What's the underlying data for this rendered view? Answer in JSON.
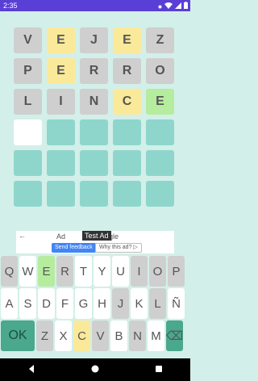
{
  "status": {
    "time": "2:35"
  },
  "board": {
    "rows": [
      [
        {
          "l": "V",
          "s": "absent"
        },
        {
          "l": "E",
          "s": "present"
        },
        {
          "l": "J",
          "s": "absent"
        },
        {
          "l": "E",
          "s": "present"
        },
        {
          "l": "Z",
          "s": "absent"
        }
      ],
      [
        {
          "l": "P",
          "s": "absent"
        },
        {
          "l": "E",
          "s": "present"
        },
        {
          "l": "R",
          "s": "absent"
        },
        {
          "l": "R",
          "s": "absent"
        },
        {
          "l": "O",
          "s": "absent"
        }
      ],
      [
        {
          "l": "L",
          "s": "absent"
        },
        {
          "l": "I",
          "s": "absent"
        },
        {
          "l": "N",
          "s": "absent"
        },
        {
          "l": "C",
          "s": "present"
        },
        {
          "l": "E",
          "s": "correct"
        }
      ],
      [
        {
          "l": "",
          "s": "active"
        },
        {
          "l": "",
          "s": "empty"
        },
        {
          "l": "",
          "s": "empty"
        },
        {
          "l": "",
          "s": "empty"
        },
        {
          "l": "",
          "s": "empty"
        }
      ],
      [
        {
          "l": "",
          "s": "empty"
        },
        {
          "l": "",
          "s": "empty"
        },
        {
          "l": "",
          "s": "empty"
        },
        {
          "l": "",
          "s": "empty"
        },
        {
          "l": "",
          "s": "empty"
        }
      ],
      [
        {
          "l": "",
          "s": "empty"
        },
        {
          "l": "",
          "s": "empty"
        },
        {
          "l": "",
          "s": "empty"
        },
        {
          "l": "",
          "s": "empty"
        },
        {
          "l": "",
          "s": "empty"
        }
      ]
    ]
  },
  "ad": {
    "title_left": "Ad",
    "title_right": "gle",
    "test_label": "Test Ad",
    "feedback_label": "Send feedback",
    "why_label": "Why this ad? ▷"
  },
  "keyboard": {
    "rows": [
      [
        {
          "k": "Q",
          "s": "absent"
        },
        {
          "k": "W",
          "s": ""
        },
        {
          "k": "E",
          "s": "correct"
        },
        {
          "k": "R",
          "s": "absent"
        },
        {
          "k": "T",
          "s": ""
        },
        {
          "k": "Y",
          "s": ""
        },
        {
          "k": "U",
          "s": ""
        },
        {
          "k": "I",
          "s": "absent"
        },
        {
          "k": "O",
          "s": "absent"
        },
        {
          "k": "P",
          "s": "absent"
        }
      ],
      [
        {
          "k": "A",
          "s": ""
        },
        {
          "k": "S",
          "s": ""
        },
        {
          "k": "D",
          "s": ""
        },
        {
          "k": "F",
          "s": ""
        },
        {
          "k": "G",
          "s": ""
        },
        {
          "k": "H",
          "s": ""
        },
        {
          "k": "J",
          "s": "absent"
        },
        {
          "k": "K",
          "s": ""
        },
        {
          "k": "L",
          "s": "absent"
        },
        {
          "k": "Ñ",
          "s": ""
        }
      ],
      [
        {
          "k": "OK",
          "s": "enter"
        },
        {
          "k": "Z",
          "s": "absent"
        },
        {
          "k": "X",
          "s": ""
        },
        {
          "k": "C",
          "s": "present"
        },
        {
          "k": "V",
          "s": "absent"
        },
        {
          "k": "B",
          "s": ""
        },
        {
          "k": "N",
          "s": "absent"
        },
        {
          "k": "M",
          "s": ""
        },
        {
          "k": "⌫",
          "s": "back"
        }
      ]
    ]
  },
  "icons": {
    "status": [
      "dot-icon",
      "wifi-icon",
      "signal-icon",
      "battery-icon"
    ],
    "nav": [
      "back-icon",
      "home-icon",
      "recents-icon"
    ]
  }
}
